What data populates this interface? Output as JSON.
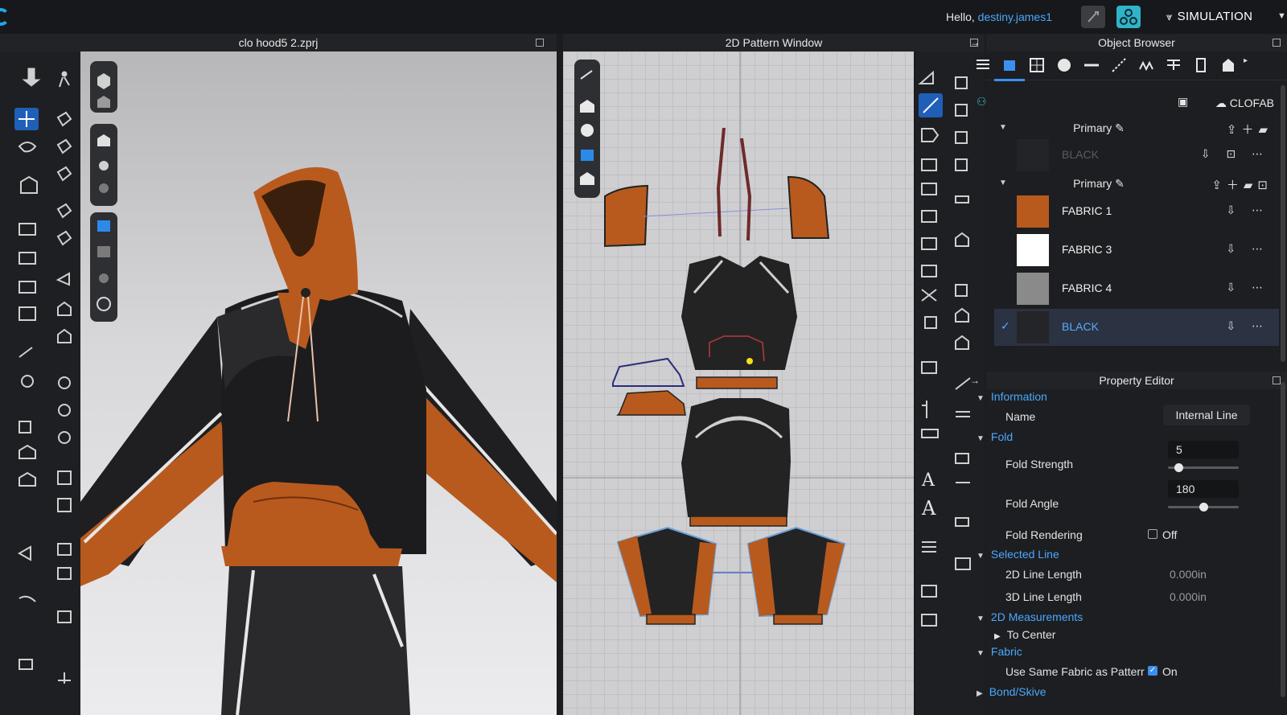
{
  "topbar": {
    "hello_prefix": "Hello,",
    "username": "destiny.james1",
    "mode_label": "SIMULATION"
  },
  "panels": {
    "viewport_3d_title": "clo hood5 2.zprj",
    "pattern_window_title": "2D Pattern Window",
    "object_browser_title": "Object Browser",
    "property_editor_title": "Property Editor"
  },
  "object_browser": {
    "library_label": "CLOFAB",
    "group1": {
      "name": "Primary",
      "items": [
        {
          "name": "BLACK",
          "color": "#232428",
          "dimmed": true
        }
      ]
    },
    "group2": {
      "name": "Primary",
      "items": [
        {
          "name": "FABRIC 1",
          "color": "#b85a1e"
        },
        {
          "name": "FABRIC 3",
          "color": "#ffffff"
        },
        {
          "name": "FABRIC 4",
          "color": "#8a8a8a"
        },
        {
          "name": "BLACK",
          "color": "#242528",
          "selected": true
        }
      ]
    }
  },
  "property_editor": {
    "information": {
      "section": "Information",
      "name_label": "Name",
      "name_value": "Internal Line"
    },
    "fold": {
      "section": "Fold",
      "strength_label": "Fold Strength",
      "strength_value": "5",
      "strength_fraction": 0.1,
      "angle_label": "Fold Angle",
      "angle_value": "180",
      "angle_fraction": 0.5,
      "rendering_label": "Fold Rendering",
      "rendering_value": "Off"
    },
    "selected_line": {
      "section": "Selected Line",
      "len2d_label": "2D Line Length",
      "len2d_value": "0.000in",
      "len3d_label": "3D Line Length",
      "len3d_value": "0.000in"
    },
    "measurements": {
      "section": "2D Measurements",
      "to_center": "To Center"
    },
    "fabric": {
      "section": "Fabric",
      "same_label": "Use Same Fabric as Patterr",
      "same_value": "On"
    },
    "bond": {
      "section": "Bond/Skive"
    }
  },
  "colors": {
    "accent": "#3c8ff0",
    "link": "#4aa8ff",
    "orange": "#b85a1e"
  }
}
